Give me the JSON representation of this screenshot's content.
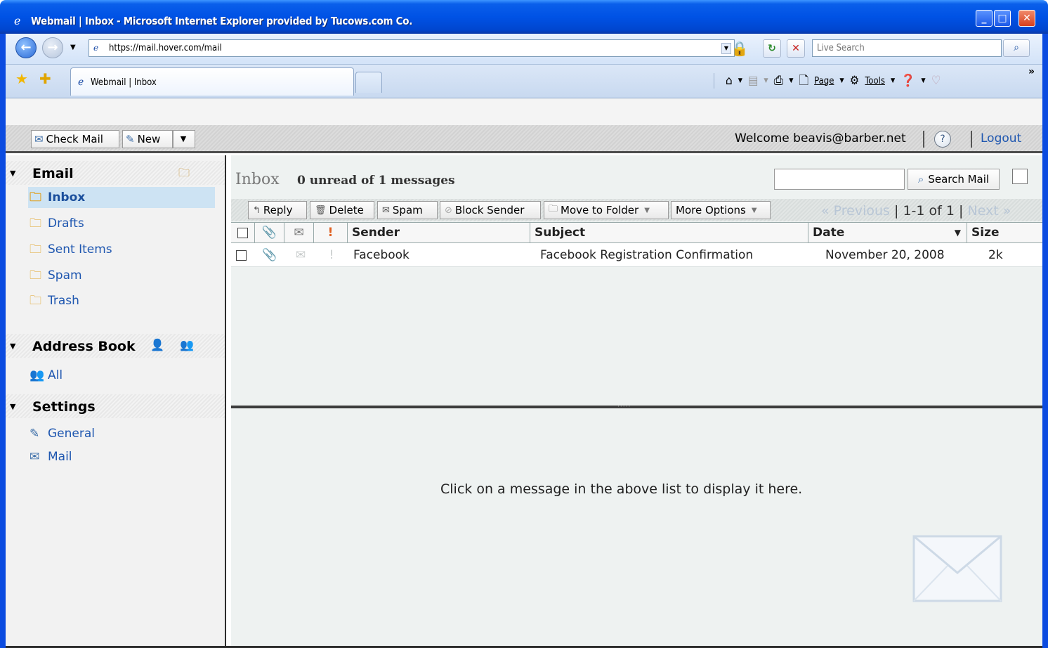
{
  "window": {
    "title": "Webmail | Inbox - Microsoft Internet Explorer provided by Tucows.com Co."
  },
  "browser": {
    "url": "https://mail.hover.com/mail",
    "search_placeholder": "Live Search",
    "tab_title": "Webmail | Inbox",
    "cmd_page": "Page",
    "cmd_tools": "Tools"
  },
  "app": {
    "check_mail_label": "Check Mail",
    "new_label": "New",
    "welcome_text": "Welcome beavis@barber.net",
    "help_label": "?",
    "logout_label": "Logout"
  },
  "sidebar": {
    "email_title": "Email",
    "folders": [
      "Inbox",
      "Drafts",
      "Sent Items",
      "Spam",
      "Trash"
    ],
    "address_book_title": "Address Book",
    "address_items": [
      "All"
    ],
    "settings_title": "Settings",
    "settings_items": [
      "General",
      "Mail"
    ]
  },
  "list": {
    "folder_title": "Inbox",
    "count_text": "0 unread of 1 messages",
    "search_button": "Search Mail",
    "toolbar": {
      "reply": "Reply",
      "delete": "Delete",
      "spam": "Spam",
      "block": "Block Sender",
      "move": "Move to Folder",
      "more": "More Options"
    },
    "pager": {
      "prev": "« Previous",
      "range": "1-1 of 1",
      "next": "Next »"
    },
    "columns": {
      "sender": "Sender",
      "subject": "Subject",
      "date": "Date",
      "size": "Size"
    },
    "messages": [
      {
        "sender": "Facebook",
        "subject": "Facebook Registration Confirmation",
        "date": "November 20, 2008",
        "size": "2k"
      }
    ]
  },
  "preview": {
    "placeholder": "Click on a message in the above list to display it here."
  },
  "colors": {
    "accent_link": "#1f57b0",
    "selected_folder": "#cde3f3",
    "titlebar": "#0052e5"
  }
}
